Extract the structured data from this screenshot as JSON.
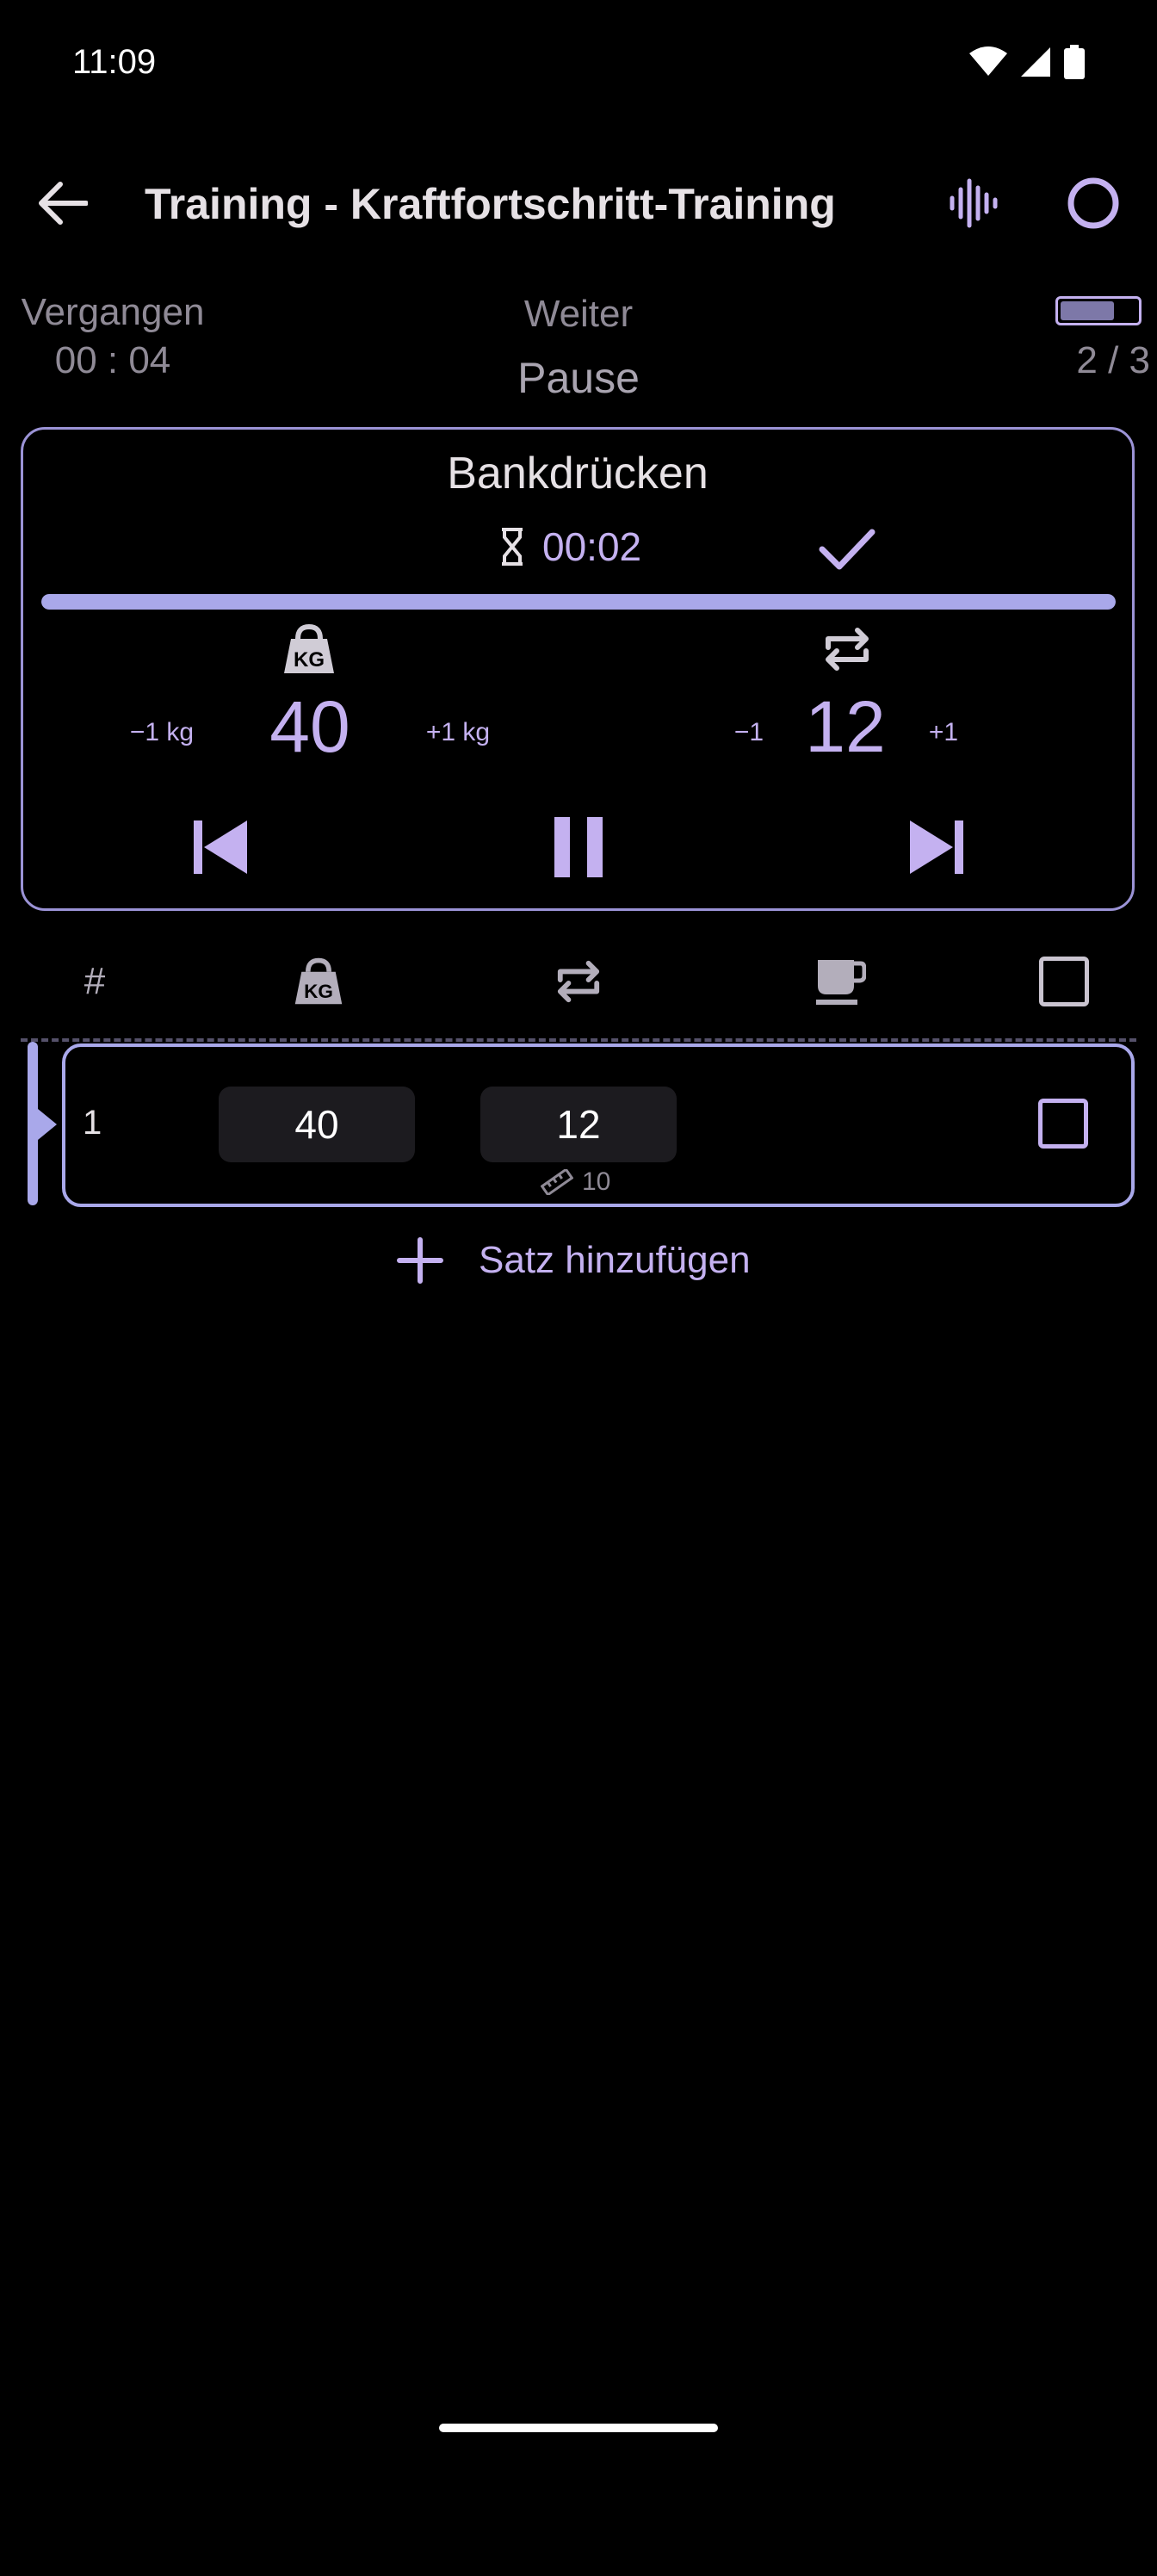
{
  "status_bar": {
    "time": "11:09"
  },
  "app_bar": {
    "title": "Training - Kraftfortschritt-Training"
  },
  "info": {
    "elapsed_label": "Vergangen",
    "elapsed_value": "00 : 04",
    "next_label": "Weiter",
    "next_value": "Pause",
    "progress": "2 / 3",
    "battery_level": 0.7
  },
  "exercise": {
    "name": "Bankdrücken",
    "timer": "00:02",
    "rest_progress": 1.0,
    "weight": {
      "value": "40",
      "minus": "−1 kg",
      "plus": "+1 kg"
    },
    "reps": {
      "value": "12",
      "minus": "−1",
      "plus": "+1"
    }
  },
  "table": {
    "header_number": "#",
    "rows": [
      {
        "number": "1",
        "weight": "40",
        "reps": "12",
        "previous_reps": "10",
        "done": false
      }
    ]
  },
  "add_set_label": "Satz hinzufügen",
  "colors": {
    "accent": "#c4b1f0",
    "background": "#000000",
    "card_border": "#9b93d6"
  }
}
